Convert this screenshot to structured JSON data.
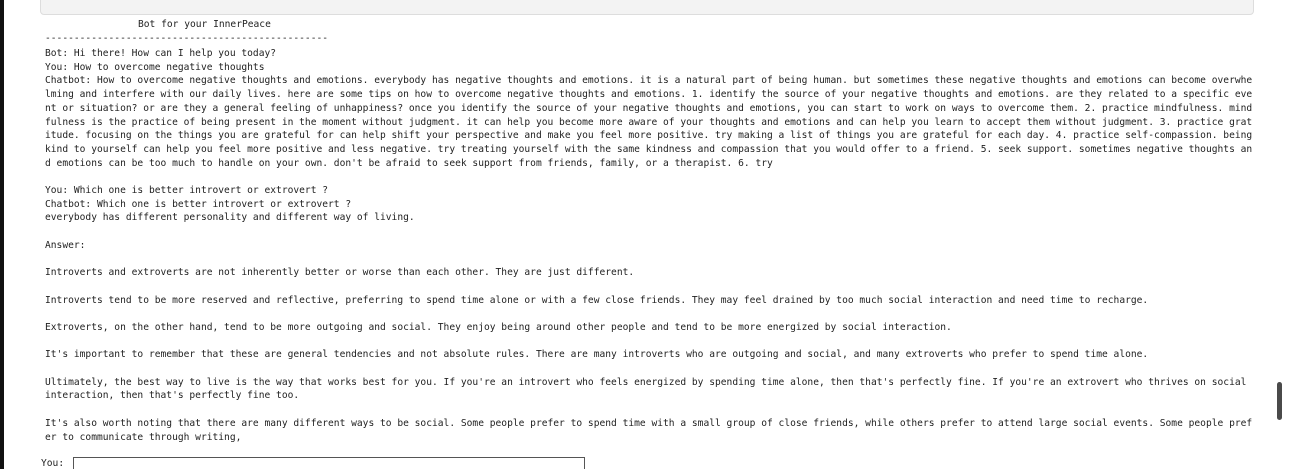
{
  "app": {
    "title": "Bot for your InnerPeace",
    "divider": "-------------------------------------------------"
  },
  "transcript": {
    "lines": [
      "Bot:  Hi there!  How can I help you today?",
      "You:  How to overcome negative thoughts",
      "Chatbot: How to overcome negative thoughts and emotions. everybody has negative thoughts and emotions. it is a natural part of being human. but sometimes these negative thoughts and emotions can become overwhelming and interfere with our daily lives. here are some tips on how to overcome negative thoughts and emotions. 1. identify the source of your negative thoughts and emotions. are they related to a specific event or situation? or are they a general feeling of unhappiness? once you identify the source of your negative thoughts and emotions, you can start to work on ways to overcome them. 2. practice mindfulness. mindfulness is the practice of being present in the moment without judgment. it can help you become more aware of your thoughts and emotions and can help you learn to accept them without judgment. 3. practice gratitude. focusing on the things you are grateful for can help shift your perspective and make you feel more positive. try making a list of things you are grateful for each day. 4. practice self-compassion. being kind to yourself can help you feel more positive and less negative. try treating yourself with the same kindness and compassion that you would offer to a friend. 5. seek support. sometimes negative thoughts and emotions can be too much to handle on your own. don't be afraid to seek support from friends, family, or a therapist. 6. try",
      "",
      "You:  Which one is better introvert or extrovert ?",
      "Chatbot: Which one is better introvert or extrovert ?",
      " everybody has different personality and different way of living.",
      "",
      "Answer:",
      "",
      "Introverts and extroverts are not inherently better or worse than each other. They are just different.",
      "",
      "Introverts tend to be more reserved and reflective, preferring to spend time alone or with a few close friends. They may feel drained by too much social interaction and need time to recharge.",
      "",
      "Extroverts, on the other hand, tend to be more outgoing and social. They enjoy being around other people and tend to be more energized by social interaction.",
      "",
      "It's important to remember that these are general tendencies and not absolute rules. There are many introverts who are outgoing and social, and many extroverts who prefer to spend time alone.",
      "",
      "Ultimately, the best way to live is the way that works best for you. If you're an introvert who feels energized by spending time alone, then that's perfectly fine. If you're an extrovert who thrives on social interaction, then that's perfectly fine too.",
      "",
      "It's also worth noting that there are many different ways to be social. Some people prefer to spend time with a small group of close friends, while others prefer to attend large social events. Some people prefer to communicate through writing,"
    ]
  },
  "input": {
    "label": "You:",
    "value": ""
  }
}
